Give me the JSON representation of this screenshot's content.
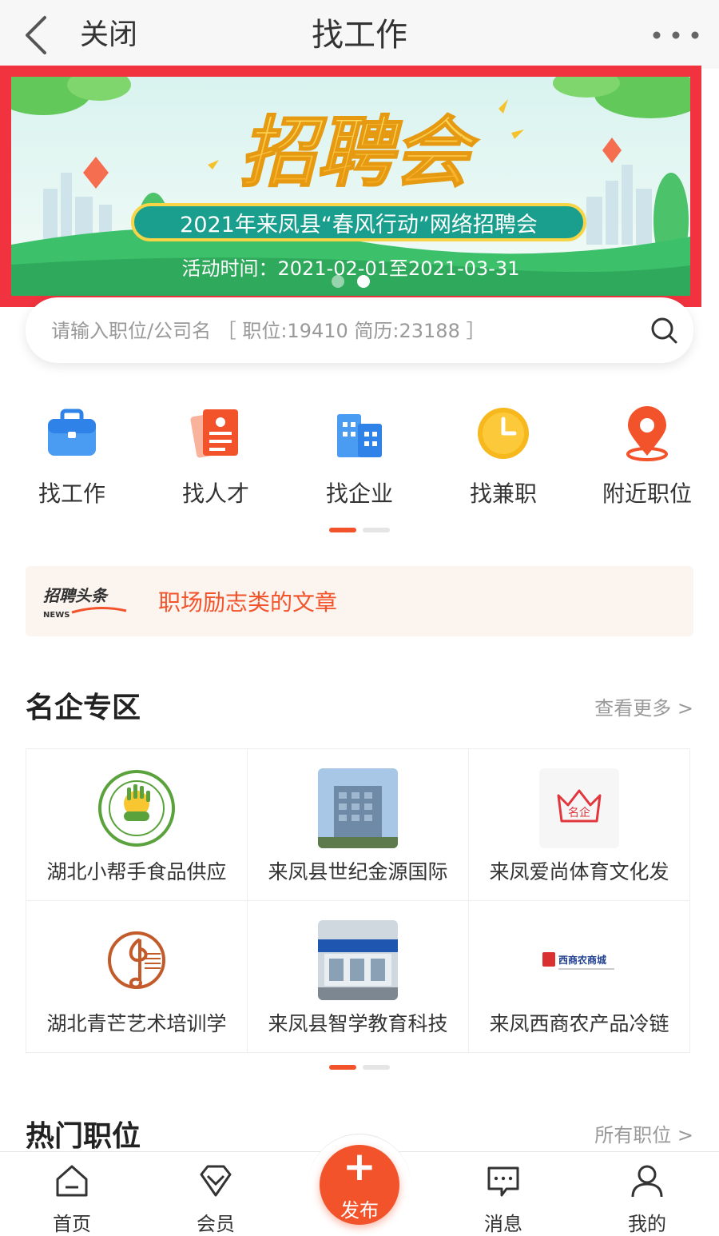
{
  "header": {
    "close_label": "关闭",
    "title": "找工作"
  },
  "banner": {
    "title": "招聘会",
    "subtitle": "2021年来凤县“春风行动”网络招聘会",
    "date": "活动时间：2021-02-01至2021-03-31",
    "dots": 2,
    "active_dot": 2
  },
  "search": {
    "placeholder": "请输入职位/公司名 ［ 职位:19410  简历:23188 ］"
  },
  "categories": [
    {
      "label": "找工作",
      "icon": "briefcase-icon",
      "color": "#3b8cf0"
    },
    {
      "label": "找人才",
      "icon": "resume-icon",
      "color": "#f2532b"
    },
    {
      "label": "找企业",
      "icon": "building-icon",
      "color": "#3b8cf0"
    },
    {
      "label": "找兼职",
      "icon": "clock-icon",
      "color": "#f7b81e"
    },
    {
      "label": "附近职位",
      "icon": "location-pin-icon",
      "color": "#f2532b"
    }
  ],
  "news": {
    "logo_text": "招聘头条",
    "logo_sub": "NEWS",
    "headline": "职场励志类的文章"
  },
  "featured": {
    "title": "名企专区",
    "more": "查看更多 >",
    "companies": [
      {
        "name": "湖北小帮手食品供应",
        "logo": "xiaobangshou-logo"
      },
      {
        "name": "来凤县世纪金源国际",
        "logo": "building-photo"
      },
      {
        "name": "来凤爱尚体育文化发",
        "logo": "mingqi-logo",
        "logo_text": "名企"
      },
      {
        "name": "湖北青芒艺术培训学",
        "logo": "music-note-logo"
      },
      {
        "name": "来凤县智学教育科技",
        "logo": "storefront-photo"
      },
      {
        "name": "来凤西商农产品冷链",
        "logo": "xishang-logo",
        "logo_text": "西商农商城"
      }
    ]
  },
  "hot_jobs": {
    "title": "热门职位",
    "more": "所有职位 >"
  },
  "tabbar": {
    "home": "首页",
    "member": "会员",
    "publish": "发布",
    "messages": "消息",
    "mine": "我的"
  },
  "colors": {
    "accent": "#f2532b",
    "highlight_frame": "#f0333e"
  }
}
